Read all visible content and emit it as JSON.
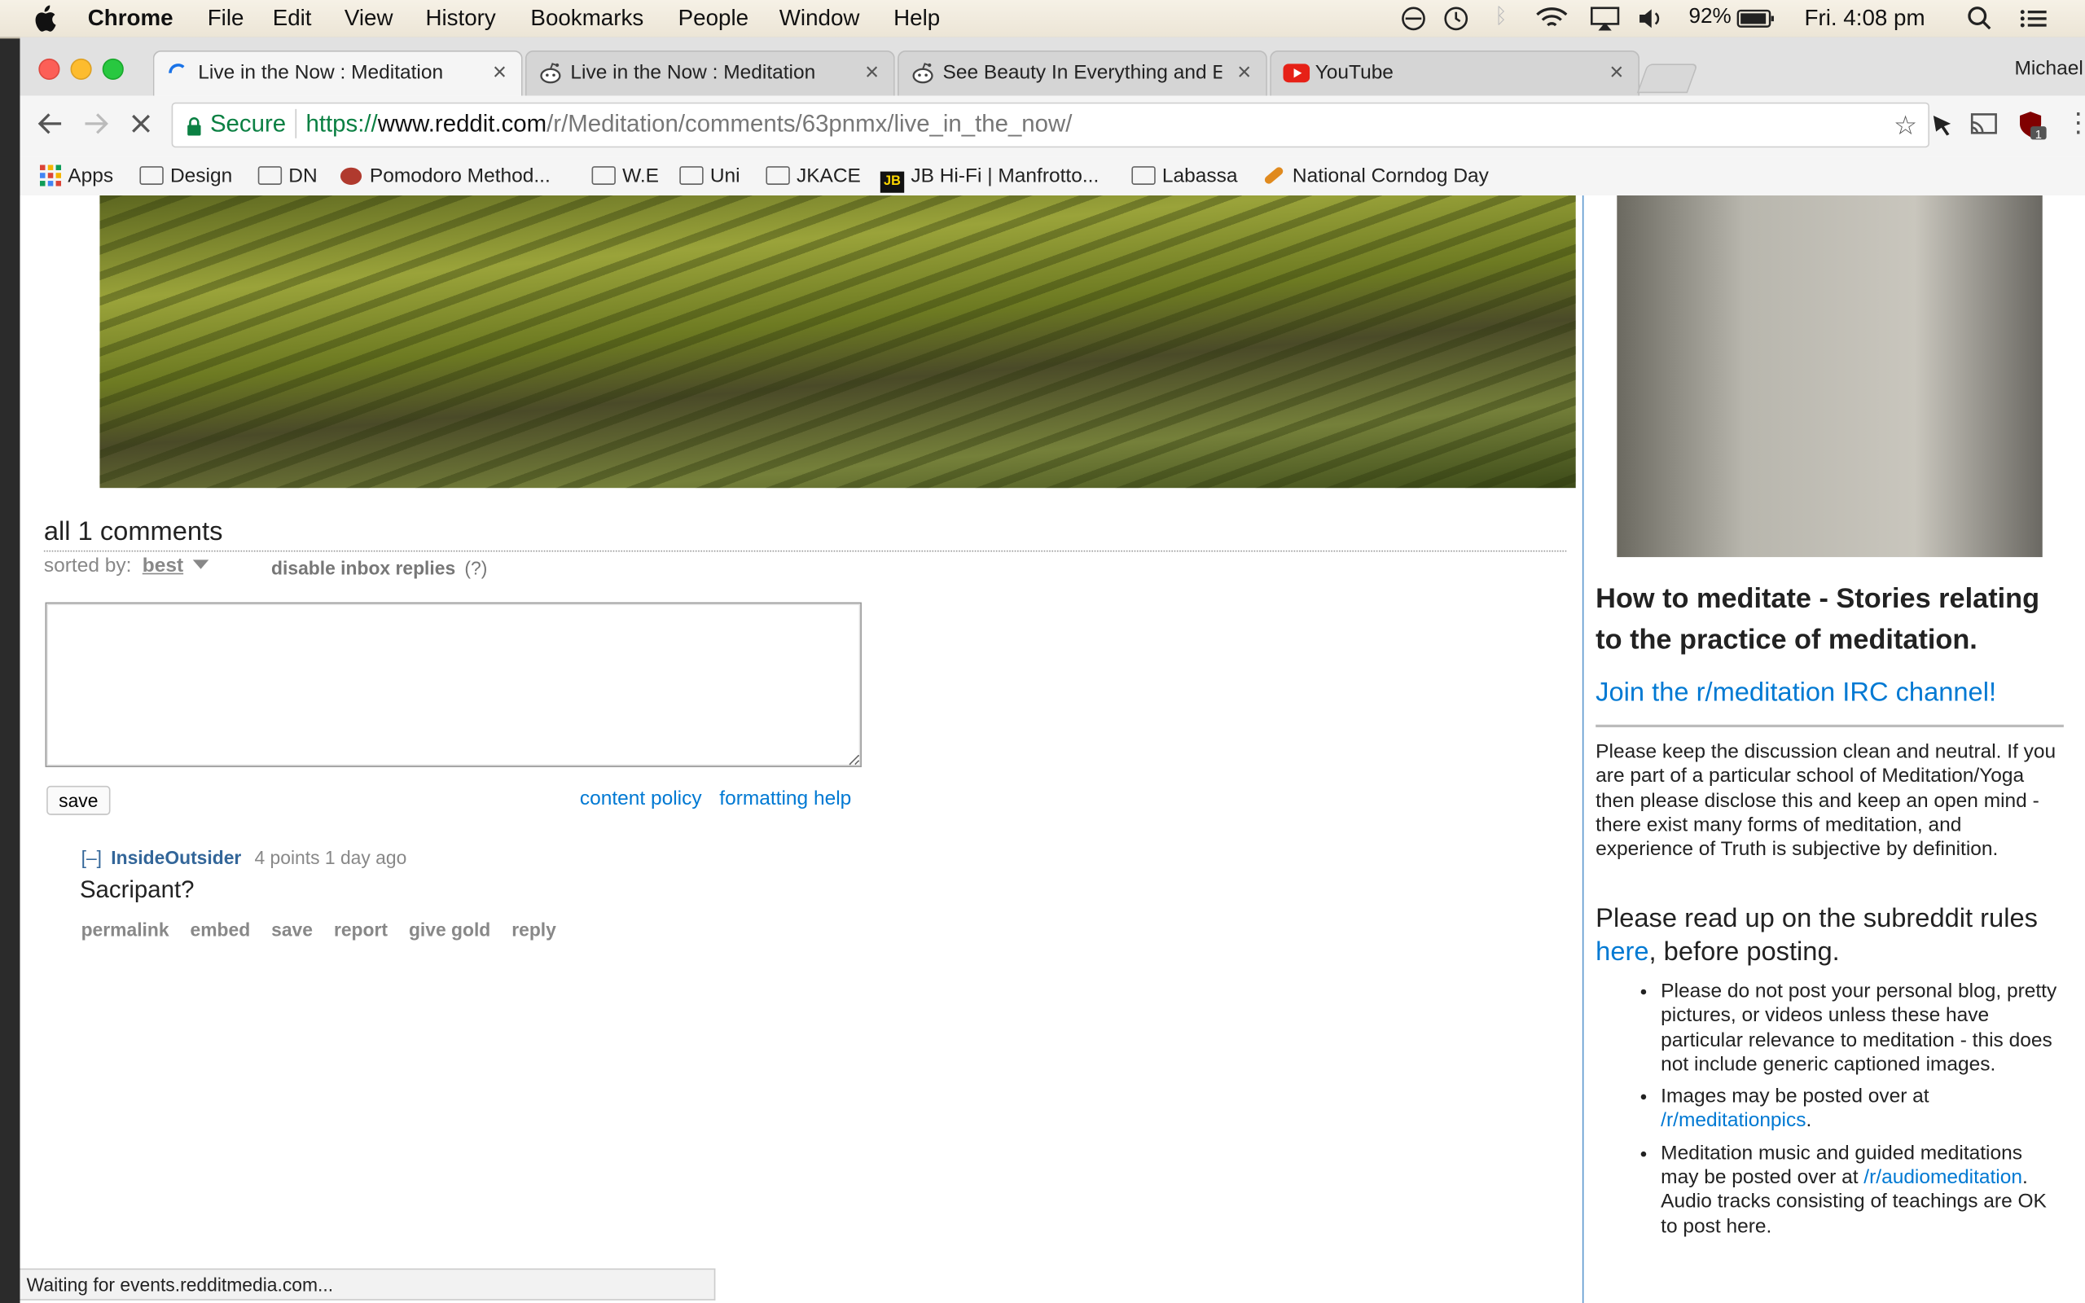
{
  "menubar": {
    "app": "Chrome",
    "items": [
      "File",
      "Edit",
      "View",
      "History",
      "Bookmarks",
      "People",
      "Window",
      "Help"
    ],
    "battery": "92%",
    "clock": "Fri. 4:08 pm"
  },
  "profile_name": "Michael",
  "tabs": [
    {
      "title": "Live in the Now : Meditation",
      "active": true
    },
    {
      "title": "Live in the Now : Meditation",
      "active": false
    },
    {
      "title": "See Beauty In Everything and E",
      "active": false
    },
    {
      "title": "YouTube",
      "active": false
    }
  ],
  "address_bar": {
    "secure_label": "Secure",
    "url_scheme": "https://",
    "url_host": "www.reddit.com",
    "url_path": "/r/Meditation/comments/63pnmx/live_in_the_now/"
  },
  "bookmarks": [
    "Apps",
    "Design",
    "DN",
    "Pomodoro Method...",
    "W.E",
    "Uni",
    "JKACE",
    "JB Hi-Fi | Manfrotto...",
    "Labassa",
    "National Corndog Day"
  ],
  "comments_area": {
    "heading": "all 1 comments",
    "sorted_by_label": "sorted by:",
    "sort_value": "best",
    "disable_inbox": "disable inbox replies",
    "help_mark": "(?)",
    "save_label": "save",
    "content_policy": "content policy",
    "formatting_help": "formatting help"
  },
  "comment": {
    "toggle": "[–]",
    "author": "InsideOutsider",
    "meta": "4 points 1 day ago",
    "body": "Sacripant?",
    "actions": [
      "permalink",
      "embed",
      "save",
      "report",
      "give gold",
      "reply"
    ]
  },
  "sidebar": {
    "title": "How to meditate - Stories relating to the practice of meditation.",
    "irc_link": "Join the r/meditation IRC channel!",
    "intro": "Please keep the discussion clean and neutral. If you are part of a particular school of Meditation/Yoga then please disclose this and keep an open mind - there exist many forms of meditation, and experience of Truth is subjective by definition.",
    "rules_prefix": "Please read up on the subreddit rules ",
    "rules_link": "here",
    "rules_suffix": ", before posting.",
    "rule1": "Please do not post your personal blog, pretty pictures, or videos unless these have particular relevance to meditation - this does not include generic captioned images.",
    "rule2_prefix": "Images may be posted over at ",
    "rule2_link": "/r/meditationpics",
    "rule2_suffix": ".",
    "rule3_prefix": "Meditation music and guided meditations may be posted over at ",
    "rule3_link": "/r/audiomeditation",
    "rule3_suffix": ". Audio tracks consisting of teachings are OK to post here."
  },
  "status_text": "Waiting for events.redditmedia.com...",
  "colors": {
    "accent": "#0079d3",
    "secure_green": "#0b8043",
    "author_blue": "#336699"
  }
}
